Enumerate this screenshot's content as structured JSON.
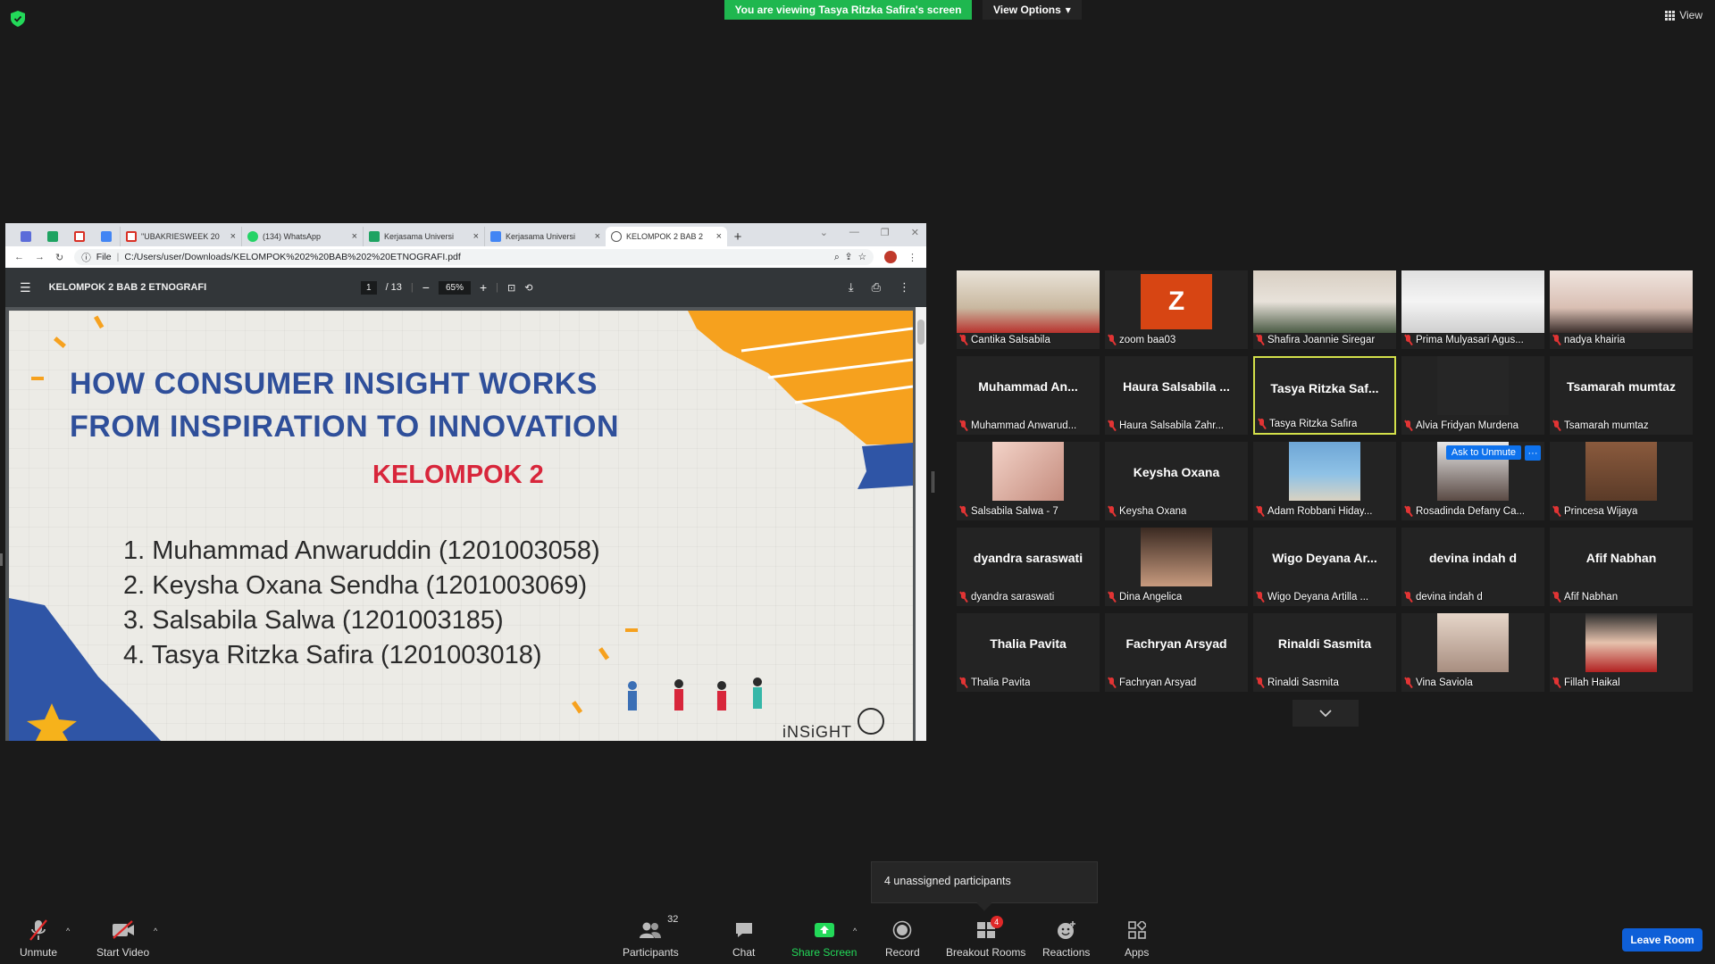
{
  "top": {
    "banner": "You are viewing Tasya Ritzka Safira's screen",
    "view_options": "View Options",
    "view": "View",
    "brand_green": "#23d959"
  },
  "browser": {
    "tabs": [
      {
        "label": "\"UBAKRIESWEEK 20",
        "icon": "gmail-icon"
      },
      {
        "label": "(134) WhatsApp",
        "icon": "whatsapp-icon"
      },
      {
        "label": "Kerjasama Universi",
        "icon": "sheets-icon"
      },
      {
        "label": "Kerjasama Universi",
        "icon": "docs-icon"
      },
      {
        "label": "KELOMPOK 2 BAB 2",
        "icon": "globe-icon"
      }
    ],
    "new_tab": "+",
    "address_scheme": "File",
    "address": "C:/Users/user/Downloads/KELOMPOK%202%20BAB%202%20ETNOGRAFI.pdf",
    "pdf": {
      "title": "KELOMPOK 2 BAB 2 ETNOGRAFI",
      "page": "1",
      "pages": "/ 13",
      "zoom": "65%"
    },
    "slide": {
      "title_line1": "HOW CONSUMER INSIGHT WORKS",
      "title_line2": "FROM INSPIRATION TO INNOVATION",
      "subtitle": "KELOMPOK 2",
      "members": [
        "1. Muhammad Anwaruddin (1201003058)",
        "2. Keysha Oxana Sendha (1201003069)",
        "3. Salsabila Salwa (1201003185)",
        "4. Tasya Ritzka Safira (1201003018)"
      ],
      "logo_text": "iNSiGHT"
    }
  },
  "participants": [
    {
      "name": "",
      "label": "Cantika Salsabila",
      "type": "video"
    },
    {
      "name": "",
      "label": "zoom baa03",
      "type": "letter",
      "letter": "Z"
    },
    {
      "name": "",
      "label": "Shafira Joannie Siregar",
      "type": "video"
    },
    {
      "name": "",
      "label": "Prima Mulyasari Agus...",
      "type": "video"
    },
    {
      "name": "",
      "label": "nadya khairia",
      "type": "video"
    },
    {
      "name": "Muhammad  An...",
      "label": "Muhammad Anwarud...",
      "type": "name"
    },
    {
      "name": "Haura  Salsabila ...",
      "label": "Haura Salsabila Zahr...",
      "type": "name"
    },
    {
      "name": "Tasya  Ritzka  Saf...",
      "label": "Tasya Ritzka Safira",
      "type": "name",
      "active": true
    },
    {
      "name": "",
      "label": "Alvia Fridyan Murdena",
      "type": "blank"
    },
    {
      "name": "Tsamarah  mumtaz",
      "label": "Tsamarah mumtaz",
      "type": "name"
    },
    {
      "name": "",
      "label": "Salsabila Salwa - 7",
      "type": "photo"
    },
    {
      "name": "Keysha Oxana",
      "label": "Keysha Oxana",
      "type": "name"
    },
    {
      "name": "",
      "label": "Adam Robbani Hiday...",
      "type": "photo"
    },
    {
      "name": "",
      "label": "Rosadinda Defany Ca...",
      "type": "photo",
      "ask": "Ask to Unmute",
      "more": "···"
    },
    {
      "name": "",
      "label": "Princesa Wijaya",
      "type": "photo"
    },
    {
      "name": "dyandra saraswati",
      "label": "dyandra saraswati",
      "type": "name"
    },
    {
      "name": "",
      "label": "Dina Angelica",
      "type": "photo"
    },
    {
      "name": "Wigo  Deyana  Ar...",
      "label": "Wigo Deyana Artilla ...",
      "type": "name"
    },
    {
      "name": "devina indah d",
      "label": "devina indah d",
      "type": "name"
    },
    {
      "name": "Afif Nabhan",
      "label": "Afif Nabhan",
      "type": "name"
    },
    {
      "name": "Thalia Pavita",
      "label": "Thalia Pavita",
      "type": "name"
    },
    {
      "name": "Fachryan Arsyad",
      "label": "Fachryan Arsyad",
      "type": "name"
    },
    {
      "name": "Rinaldi Sasmita",
      "label": "Rinaldi Sasmita",
      "type": "name"
    },
    {
      "name": "",
      "label": "Vina Saviola",
      "type": "photo"
    },
    {
      "name": "",
      "label": "Fillah Haikal",
      "type": "photo"
    }
  ],
  "popup": {
    "text": "4 unassigned participants"
  },
  "toolbar": {
    "unmute": "Unmute",
    "start_video": "Start Video",
    "participants": "Participants",
    "participants_count": "32",
    "chat": "Chat",
    "share_screen": "Share Screen",
    "record": "Record",
    "breakout_rooms": "Breakout Rooms",
    "breakout_badge": "4",
    "reactions": "Reactions",
    "apps": "Apps",
    "leave_room": "Leave Room",
    "leave_color": "#0e5fd8"
  }
}
